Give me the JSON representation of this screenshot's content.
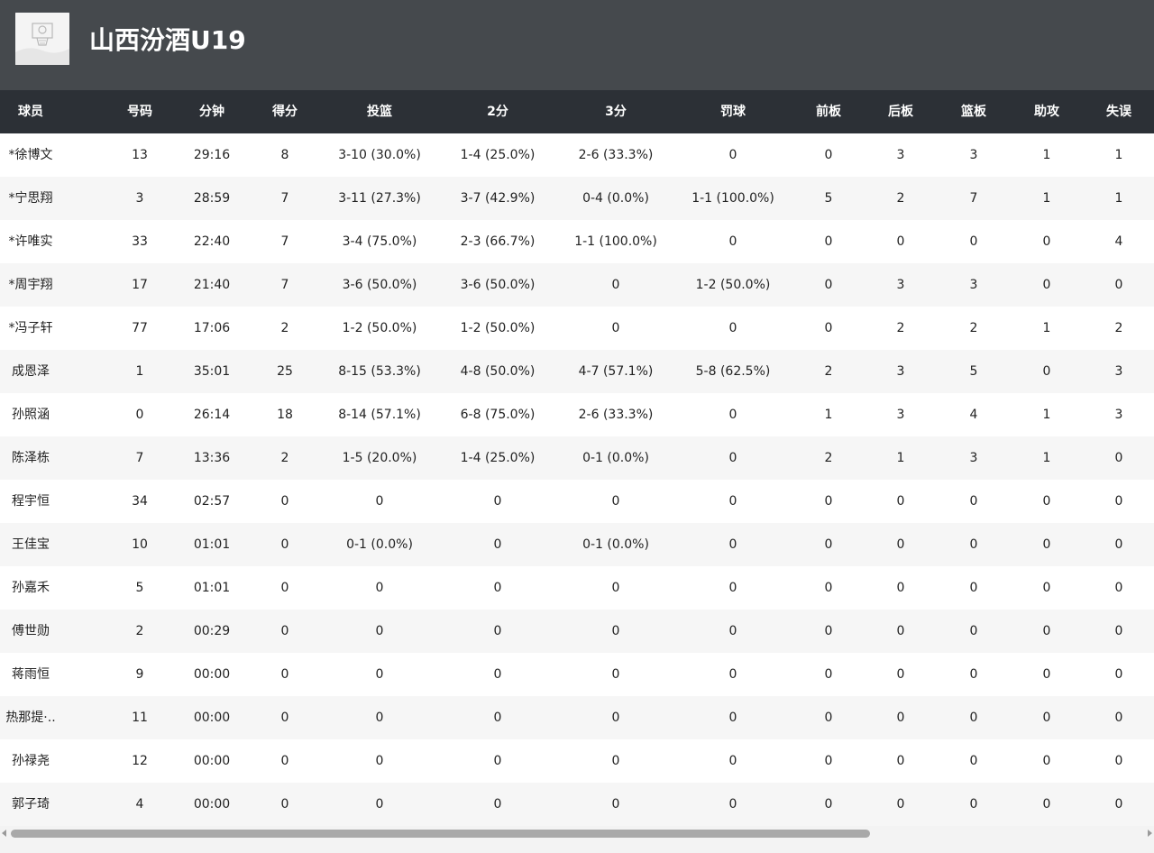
{
  "team": {
    "name": "山西汾酒U19",
    "logo_icon": "basketball-team-logo-icon"
  },
  "columns": [
    "球员",
    "号码",
    "分钟",
    "得分",
    "投篮",
    "2分",
    "3分",
    "罚球",
    "前板",
    "后板",
    "篮板",
    "助攻",
    "失误"
  ],
  "players": [
    [
      "*徐博文",
      "13",
      "29:16",
      "8",
      "3-10 (30.0%)",
      "1-4 (25.0%)",
      "2-6 (33.3%)",
      "0",
      "0",
      "3",
      "3",
      "1",
      "1"
    ],
    [
      "*宁思翔",
      "3",
      "28:59",
      "7",
      "3-11 (27.3%)",
      "3-7 (42.9%)",
      "0-4 (0.0%)",
      "1-1 (100.0%)",
      "5",
      "2",
      "7",
      "1",
      "1"
    ],
    [
      "*许唯实",
      "33",
      "22:40",
      "7",
      "3-4 (75.0%)",
      "2-3 (66.7%)",
      "1-1 (100.0%)",
      "0",
      "0",
      "0",
      "0",
      "0",
      "4"
    ],
    [
      "*周宇翔",
      "17",
      "21:40",
      "7",
      "3-6 (50.0%)",
      "3-6 (50.0%)",
      "0",
      "1-2 (50.0%)",
      "0",
      "3",
      "3",
      "0",
      "0"
    ],
    [
      "*冯子轩",
      "77",
      "17:06",
      "2",
      "1-2 (50.0%)",
      "1-2 (50.0%)",
      "0",
      "0",
      "0",
      "2",
      "2",
      "1",
      "2"
    ],
    [
      "成恩泽",
      "1",
      "35:01",
      "25",
      "8-15 (53.3%)",
      "4-8 (50.0%)",
      "4-7 (57.1%)",
      "5-8 (62.5%)",
      "2",
      "3",
      "5",
      "0",
      "3"
    ],
    [
      "孙照涵",
      "0",
      "26:14",
      "18",
      "8-14 (57.1%)",
      "6-8 (75.0%)",
      "2-6 (33.3%)",
      "0",
      "1",
      "3",
      "4",
      "1",
      "3"
    ],
    [
      "陈泽栋",
      "7",
      "13:36",
      "2",
      "1-5 (20.0%)",
      "1-4 (25.0%)",
      "0-1 (0.0%)",
      "0",
      "2",
      "1",
      "3",
      "1",
      "0"
    ],
    [
      "程宇恒",
      "34",
      "02:57",
      "0",
      "0",
      "0",
      "0",
      "0",
      "0",
      "0",
      "0",
      "0",
      "0"
    ],
    [
      "王佳宝",
      "10",
      "01:01",
      "0",
      "0-1 (0.0%)",
      "0",
      "0-1 (0.0%)",
      "0",
      "0",
      "0",
      "0",
      "0",
      "0"
    ],
    [
      "孙嘉禾",
      "5",
      "01:01",
      "0",
      "0",
      "0",
      "0",
      "0",
      "0",
      "0",
      "0",
      "0",
      "0"
    ],
    [
      "傅世勋",
      "2",
      "00:29",
      "0",
      "0",
      "0",
      "0",
      "0",
      "0",
      "0",
      "0",
      "0",
      "0"
    ],
    [
      "蒋雨恒",
      "9",
      "00:00",
      "0",
      "0",
      "0",
      "0",
      "0",
      "0",
      "0",
      "0",
      "0",
      "0"
    ],
    [
      "热那提·..",
      "11",
      "00:00",
      "0",
      "0",
      "0",
      "0",
      "0",
      "0",
      "0",
      "0",
      "0",
      "0"
    ],
    [
      "孙禄尧",
      "12",
      "00:00",
      "0",
      "0",
      "0",
      "0",
      "0",
      "0",
      "0",
      "0",
      "0",
      "0"
    ],
    [
      "郭子琦",
      "4",
      "00:00",
      "0",
      "0",
      "0",
      "0",
      "0",
      "0",
      "0",
      "0",
      "0",
      "0"
    ]
  ],
  "scrollbar": {
    "left_arrow_icon": "caret-left-icon",
    "right_arrow_icon": "caret-right-icon"
  }
}
